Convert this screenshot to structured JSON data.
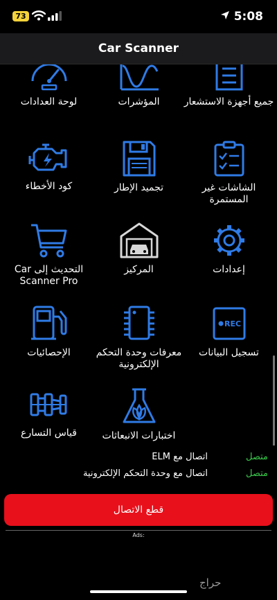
{
  "status_bar": {
    "battery": "73",
    "time": "5:08"
  },
  "nav": {
    "title": "Car Scanner"
  },
  "accent_color": "#2f7be6",
  "grid": {
    "dashboard": {
      "label": "لوحة العدادات",
      "icon": "dashboard-gauge-icon"
    },
    "charts": {
      "label": "المؤشرات",
      "icon": "sine-chart-icon"
    },
    "all_sensors": {
      "label": "جميع أجهزة الاستشعار",
      "icon": "list-icon"
    },
    "error_codes": {
      "label": "كود الأخطاء",
      "icon": "engine-icon"
    },
    "freeze_frame": {
      "label": "تجميد الإطار",
      "icon": "floppy-disk-icon"
    },
    "noncontinuous": {
      "label": "الشاشات غير المستمرة",
      "icon": "clipboard-check-icon"
    },
    "upgrade": {
      "label": "التحديث إلى Car Scanner Pro",
      "icon": "cart-icon"
    },
    "garage": {
      "label": "المركيز",
      "icon": "garage-icon"
    },
    "settings": {
      "label": "إعدادات",
      "icon": "gear-icon"
    },
    "statistics": {
      "label": "الإحصائيات",
      "icon": "fuel-pump-icon"
    },
    "ecu_ids": {
      "label": "معرفات وحدة التحكم الإلكترونية",
      "icon": "chip-icon"
    },
    "data_recording": {
      "label": "تسجيل البيانات",
      "icon": "rec-icon",
      "badge": "REC"
    },
    "acceleration": {
      "label": "قياس التسارع",
      "icon": "race-car-icon"
    },
    "emissions": {
      "label": "اختبارات الانبعاثات",
      "icon": "flask-icon"
    }
  },
  "connection": {
    "elm_label": "اتصال مع ELM",
    "elm_status": "متصل",
    "ecu_label": "اتصال مع وحدة التحكم الإلكترونية",
    "ecu_status": "متصل"
  },
  "disconnect_label": "قطع الاتصال",
  "ads_label": "Ads:",
  "watermark": "حراج"
}
